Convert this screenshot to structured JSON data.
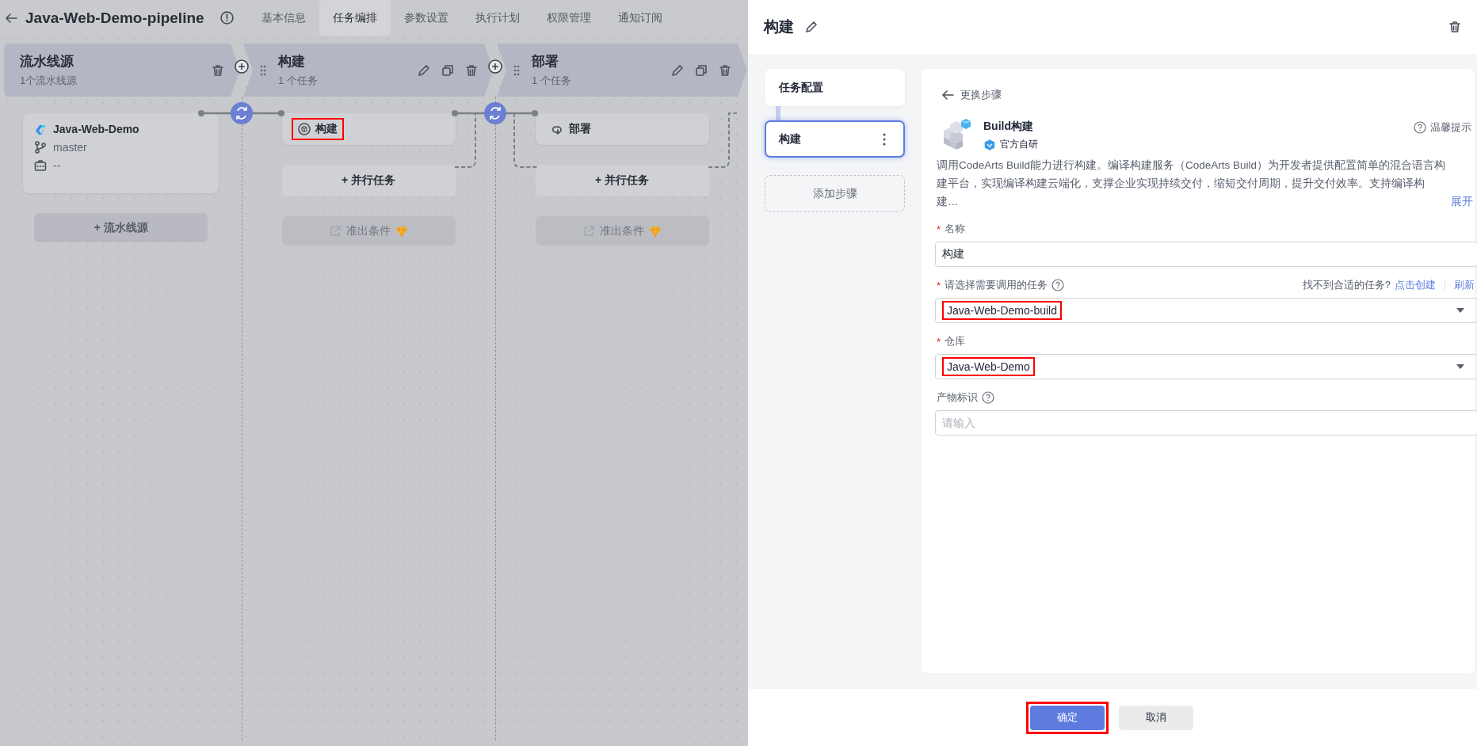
{
  "header": {
    "title": "Java-Web-Demo-pipeline"
  },
  "tabs": [
    {
      "label": "基本信息",
      "selected": false
    },
    {
      "label": "任务编排",
      "selected": true
    },
    {
      "label": "参数设置",
      "selected": false
    },
    {
      "label": "执行计划",
      "selected": false
    },
    {
      "label": "权限管理",
      "selected": false
    },
    {
      "label": "通知订阅",
      "selected": false
    }
  ],
  "stages": [
    {
      "kind": "source",
      "title": "流水线源",
      "subtitle": "1个流水线源",
      "source": {
        "name": "Java-Web-Demo",
        "branch": "master",
        "tag": "--"
      },
      "add_label": "+ 流水线源"
    },
    {
      "kind": "stage",
      "title": "构建",
      "subtitle": "1 个任务",
      "jobs": [
        {
          "kind": "build",
          "name": "构建",
          "highlighted": true
        }
      ],
      "parallel_label": "+ 并行任务",
      "exit": {
        "label": "准出条件",
        "disabled": true
      }
    },
    {
      "kind": "stage",
      "title": "部署",
      "subtitle": "1 个任务",
      "jobs": [
        {
          "kind": "deploy",
          "name": "部署",
          "highlighted": false
        }
      ],
      "parallel_label": "+ 并行任务",
      "exit": {
        "label": "准出条件",
        "disabled": true
      }
    }
  ],
  "panel": {
    "title": "构建",
    "steps": [
      {
        "kind": "group",
        "label": "任务配置",
        "selected": false
      },
      {
        "kind": "step",
        "label": "构建",
        "selected": true
      }
    ],
    "add_step": "添加步骤",
    "back_label": "更换步骤",
    "plugin": {
      "name": "Build构建",
      "badge": "官方自研",
      "tip": "温馨提示",
      "description": "调用CodeArts Build能力进行构建。编译构建服务（CodeArts Build）为开发者提供配置简单的混合语言构建平台，实现编译构建云端化，支撑企业实现持续交付，缩短交付周期，提升交付效率。支持编译构建…",
      "expand": "展开"
    },
    "fields": [
      {
        "kind": "input",
        "required_mark": "*",
        "label": "名称",
        "help": false,
        "value": "构建"
      },
      {
        "kind": "select",
        "required_mark": "*",
        "label": "请选择需要调用的任务",
        "help": true,
        "value": "Java-Web-Demo-build",
        "highlighted": true,
        "hint": "找不到合适的任务?",
        "links": [
          "点击创建",
          "刷新"
        ]
      },
      {
        "kind": "select",
        "required_mark": "*",
        "label": "仓库",
        "help": false,
        "value": "Java-Web-Demo",
        "highlighted": true
      },
      {
        "kind": "input",
        "label": "产物标识",
        "help": true,
        "placeholder": "请输入"
      }
    ],
    "buttons": [
      {
        "kind": "primary",
        "label": "确定",
        "highlighted": true
      },
      {
        "kind": "secondary",
        "label": "取消",
        "highlighted": false
      }
    ]
  }
}
